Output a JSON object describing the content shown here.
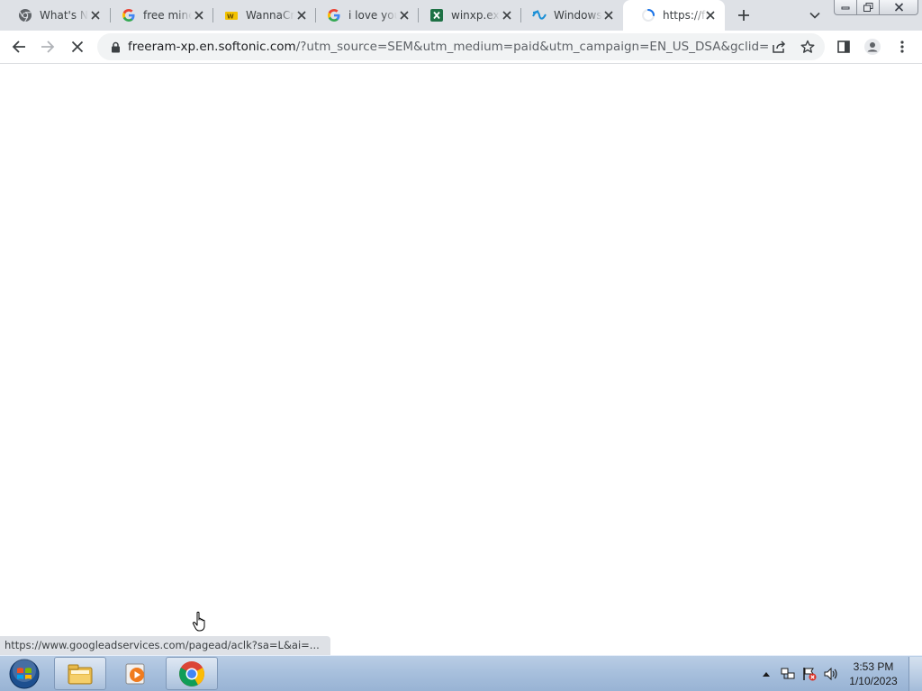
{
  "tabs": [
    {
      "title": "What's N",
      "icon": "chrome-icon",
      "active": false
    },
    {
      "title": "free mine",
      "icon": "google-icon",
      "active": false
    },
    {
      "title": "WannaCr",
      "icon": "wannacry-icon",
      "active": false
    },
    {
      "title": "i love you",
      "icon": "google-icon",
      "active": false
    },
    {
      "title": "winxp.exe",
      "icon": "excel-icon",
      "active": false
    },
    {
      "title": "Windows",
      "icon": "windows-site-icon",
      "active": false
    },
    {
      "title": "https://fr",
      "icon": "loading-spinner-icon",
      "active": true
    }
  ],
  "toolbar": {
    "url_host": "freeram-xp.en.softonic.com",
    "url_rest": "/?utm_source=SEM&utm_medium=paid&utm_campaign=EN_US_DSA&gclid=EAIaIQ..."
  },
  "status_bar": {
    "text": "https://www.googleadservices.com/pagead/aclk?sa=L&ai=..."
  },
  "taskbar": {
    "time": "3:53 PM",
    "date": "1/10/2023"
  },
  "colors": {
    "tabstrip_bg": "#dee1e6",
    "omnibox_bg": "#f1f3f4",
    "spinner": "#1a73e8"
  }
}
